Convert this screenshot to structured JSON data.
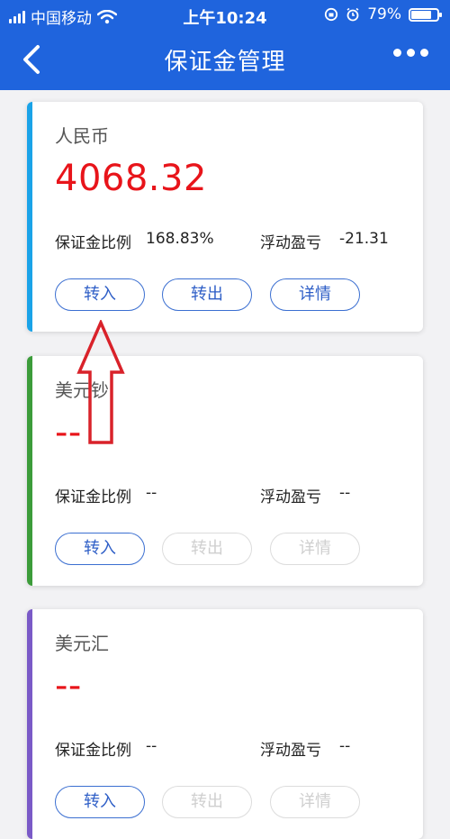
{
  "status_bar": {
    "carrier": "中国移动",
    "time": "上午10:24",
    "battery": "79%",
    "battery_level": 0.79
  },
  "nav": {
    "title": "保证金管理"
  },
  "colors": {
    "header": "#1f64dd",
    "amount": "#e8141a",
    "button": "#3b6fd1",
    "annotation_arrow": "#d9222a"
  },
  "cards": [
    {
      "currency": "人民币",
      "amount": "4068.32",
      "margin_ratio_label": "保证金比例",
      "margin_ratio_value": "168.83%",
      "pnl_label": "浮动盈亏",
      "pnl_value": "-21.31",
      "buttons": [
        {
          "label": "转入"
        },
        {
          "label": "转出"
        },
        {
          "label": "详情"
        }
      ],
      "accent_color": "#1aa3e8"
    },
    {
      "currency": "美元钞",
      "amount": "--",
      "margin_ratio_label": "保证金比例",
      "margin_ratio_value": "--",
      "pnl_label": "浮动盈亏",
      "pnl_value": "--",
      "buttons": [
        {
          "label": "转入"
        },
        {
          "label": "转出"
        },
        {
          "label": "详情"
        }
      ],
      "accent_color": "#3c9c3a"
    },
    {
      "currency": "美元汇",
      "amount": "--",
      "margin_ratio_label": "保证金比例",
      "margin_ratio_value": "--",
      "pnl_label": "浮动盈亏",
      "pnl_value": "--",
      "buttons": [
        {
          "label": "转入"
        },
        {
          "label": "转出"
        },
        {
          "label": "详情"
        }
      ],
      "accent_color": "#7a5ac7"
    }
  ]
}
